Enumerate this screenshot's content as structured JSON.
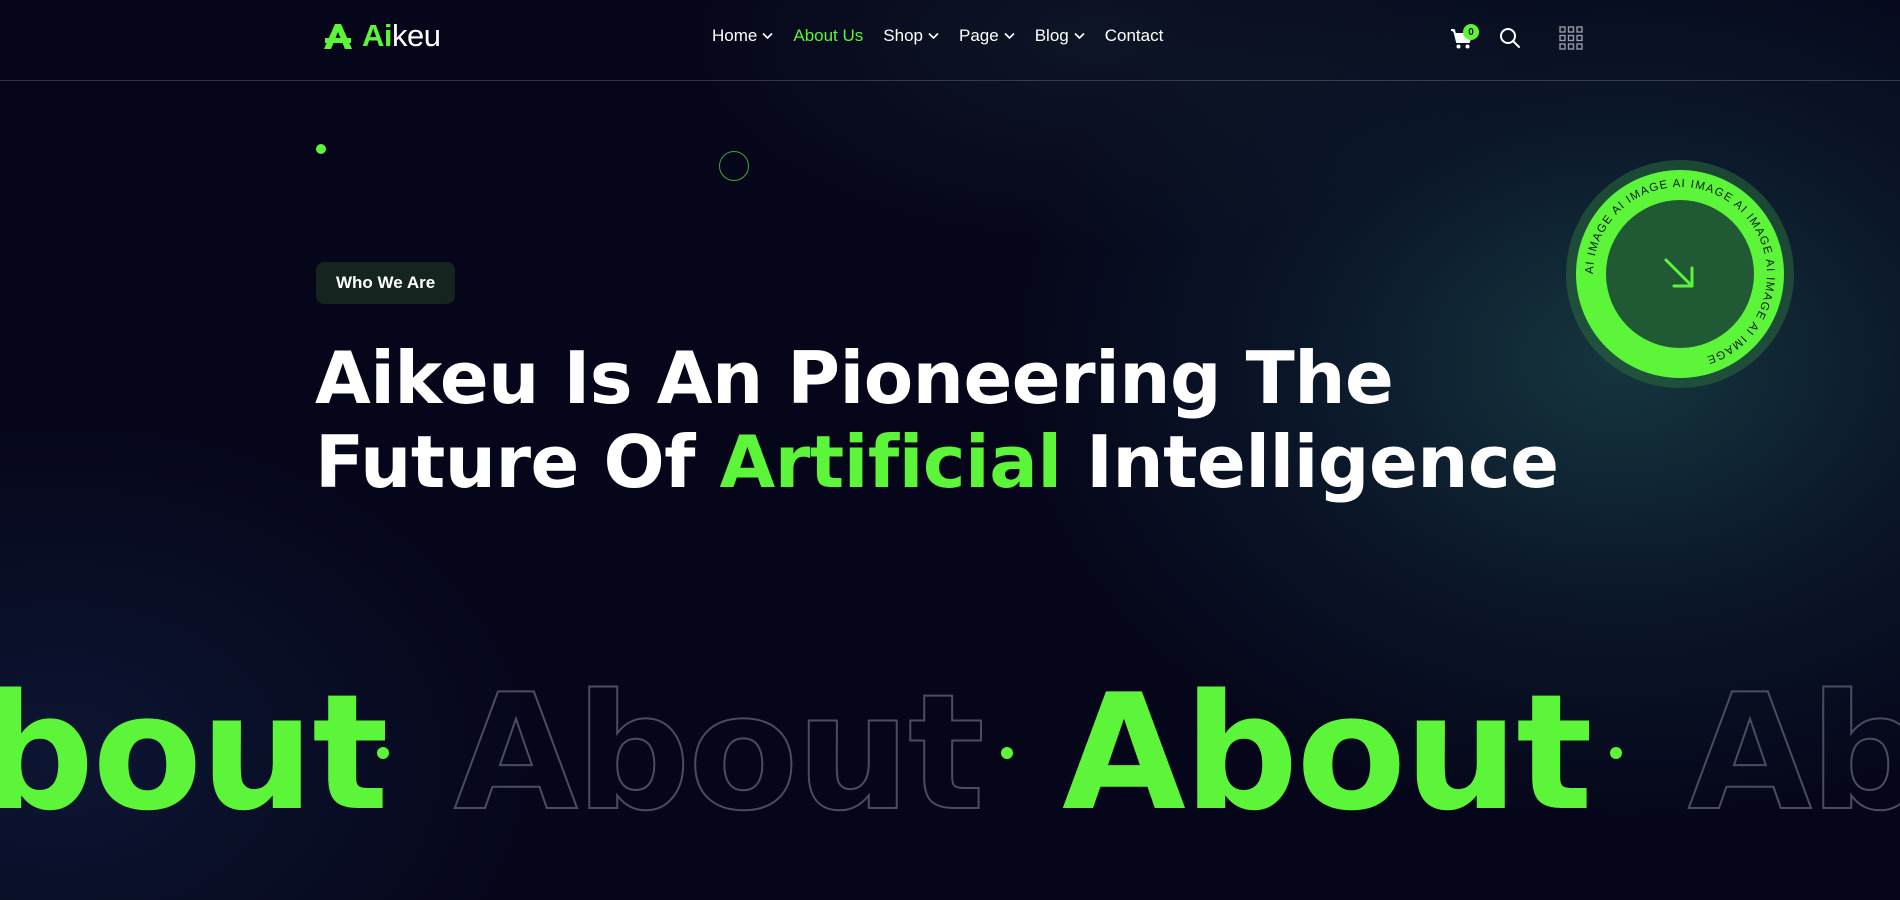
{
  "brand": {
    "name_prefix": "Ai",
    "name_suffix": "keu"
  },
  "nav": {
    "items": [
      {
        "label": "Home",
        "has_dropdown": true,
        "active": false
      },
      {
        "label": "About Us",
        "has_dropdown": false,
        "active": true
      },
      {
        "label": "Shop",
        "has_dropdown": true,
        "active": false
      },
      {
        "label": "Page",
        "has_dropdown": true,
        "active": false
      },
      {
        "label": "Blog",
        "has_dropdown": true,
        "active": false
      },
      {
        "label": "Contact",
        "has_dropdown": false,
        "active": false
      }
    ]
  },
  "header_icons": {
    "cart_count": "0",
    "cart_icon": "shopping-cart-icon",
    "search_icon": "search-icon",
    "menu_icon": "grid-menu-icon"
  },
  "hero": {
    "badge_label": "Who We Are",
    "headline_line1": "Aikeu Is An Pioneering The",
    "headline_line2_start": "Future Of ",
    "headline_highlight": "Artificial",
    "headline_line2_end": " Intelligence",
    "rotating_badge_text": "AI IMAGE",
    "rotating_badge_icon": "arrow-down-right-icon"
  },
  "marquee": {
    "word": "About"
  },
  "colors": {
    "accent": "#5cf53a",
    "background": "#06061a",
    "badge_bg": "#15241f",
    "outline_text": "#4b4b62"
  }
}
